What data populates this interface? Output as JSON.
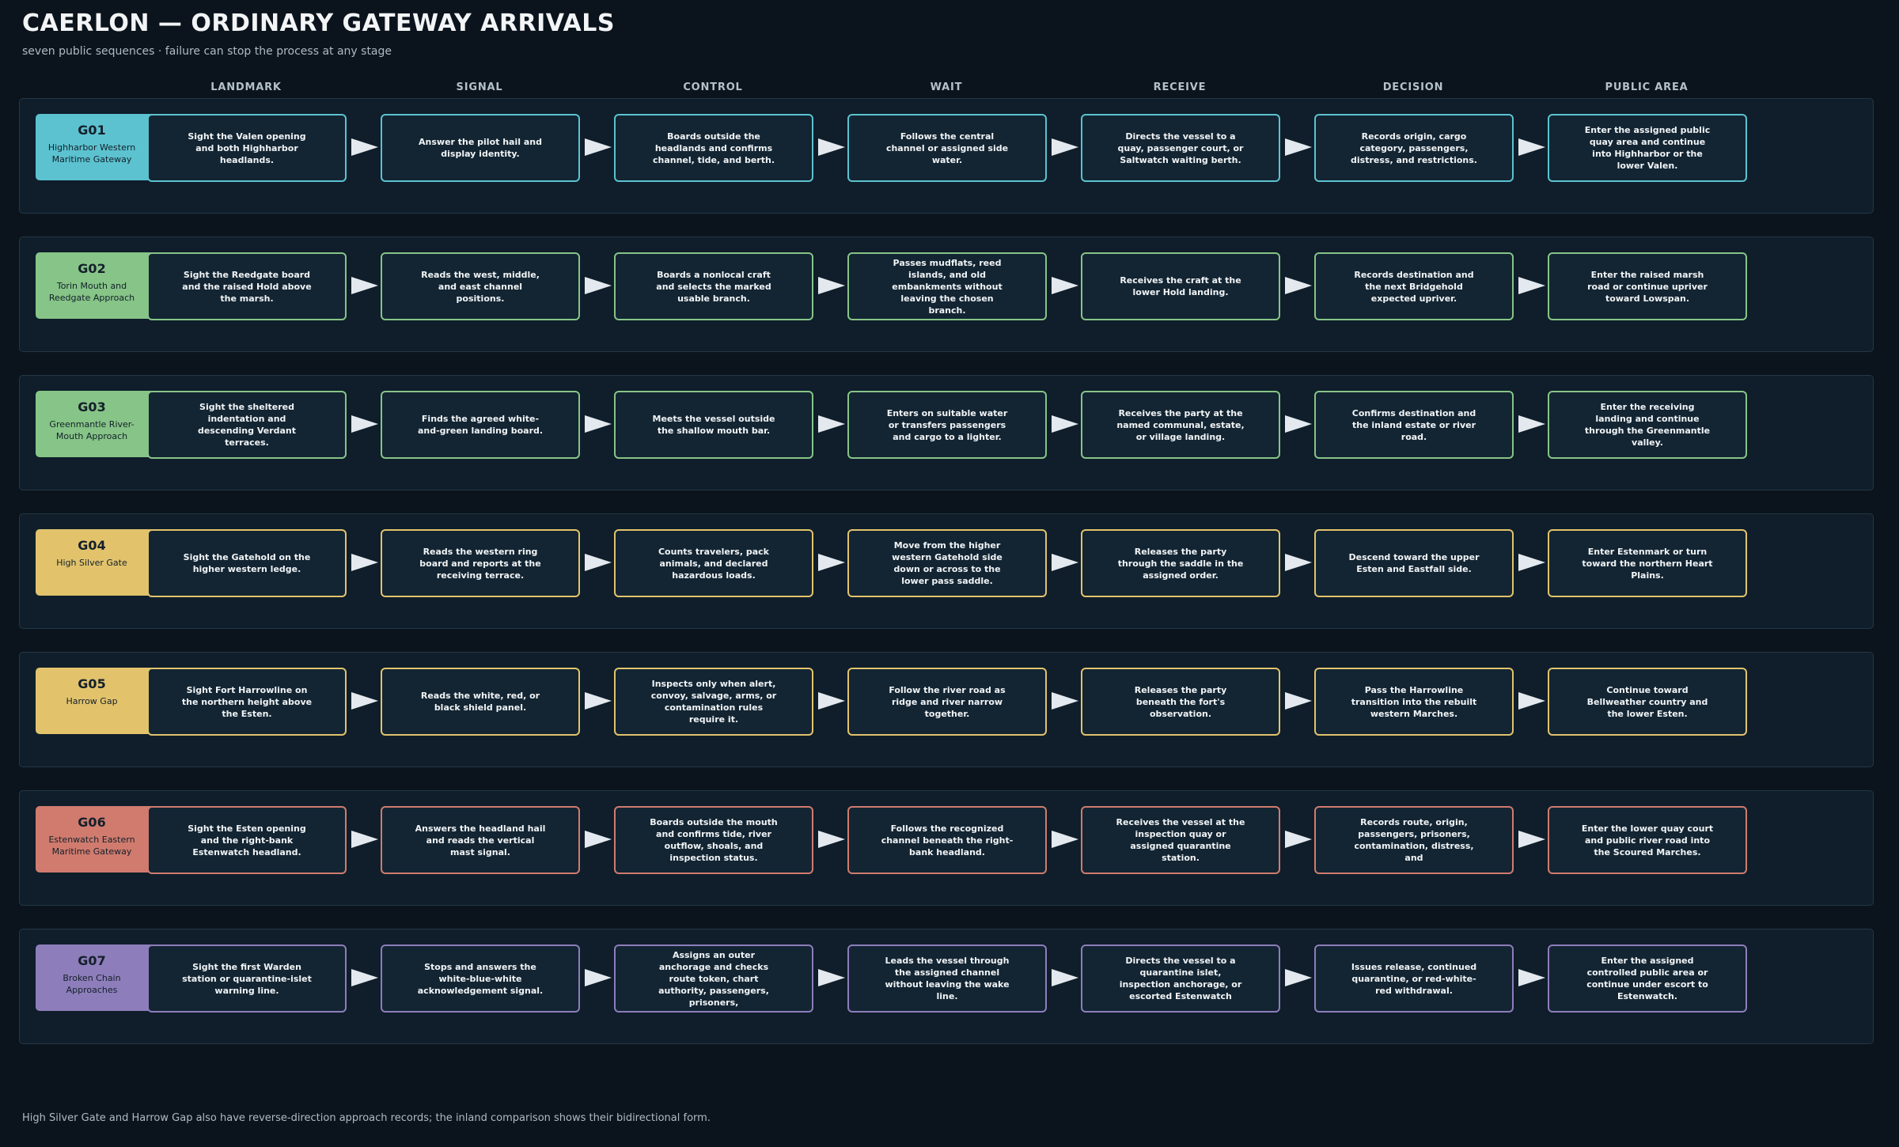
{
  "title": "CAERLON — ORDINARY GATEWAY ARRIVALS",
  "subtitle": "seven public sequences · failure can stop the process at any stage",
  "columns": [
    "LANDMARK",
    "SIGNAL",
    "CONTROL",
    "WAIT",
    "RECEIVE",
    "DECISION",
    "PUBLIC AREA"
  ],
  "gateways": [
    {
      "id": "G01",
      "name": "Highharbor Western Maritime Gateway",
      "color": "#5cc2d0",
      "steps": [
        "Sight the Valen opening and both Highharbor headlands.",
        "Answer the pilot hail and display identity.",
        "Boards outside the headlands and confirms channel, tide, and berth.",
        "Follows the central channel or assigned side water.",
        "Directs the vessel to a quay, passenger court, or Saltwatch waiting berth.",
        "Records origin, cargo category, passengers, distress, and restrictions.",
        "Enter the assigned public quay area and continue into Highharbor or the lower Valen."
      ]
    },
    {
      "id": "G02",
      "name": "Torin Mouth and Reedgate Approach",
      "color": "#86c487",
      "steps": [
        "Sight the Reedgate board and the raised Hold above the marsh.",
        "Reads the west, middle, and east channel positions.",
        "Boards a nonlocal craft and selects the marked usable branch.",
        "Passes mudflats, reed islands, and old embankments without leaving the chosen branch.",
        "Receives the craft at the lower Hold landing.",
        "Records destination and the next Bridgehold expected upriver.",
        "Enter the raised marsh road or continue upriver toward Lowspan."
      ]
    },
    {
      "id": "G03",
      "name": "Greenmantle River-Mouth Approach",
      "color": "#86c487",
      "steps": [
        "Sight the sheltered indentation and descending Verdant terraces.",
        "Finds the agreed white-and-green landing board.",
        "Meets the vessel outside the shallow mouth bar.",
        "Enters on suitable water or transfers passengers and cargo to a lighter.",
        "Receives the party at the named communal, estate, or village landing.",
        "Confirms destination and the inland estate or river road.",
        "Enter the receiving landing and continue through the Greenmantle valley."
      ]
    },
    {
      "id": "G04",
      "name": "High Silver Gate",
      "color": "#e2c36c",
      "steps": [
        "Sight the Gatehold on the higher western ledge.",
        "Reads the western ring board and reports at the receiving terrace.",
        "Counts travelers, pack animals, and declared hazardous loads.",
        "Move from the higher western Gatehold side down or across to the lower pass saddle.",
        "Releases the party through the saddle in the assigned order.",
        "Descend toward the upper Esten and Eastfall side.",
        "Enter Estenmark or turn toward the northern Heart Plains."
      ]
    },
    {
      "id": "G05",
      "name": "Harrow Gap",
      "color": "#e2c36c",
      "steps": [
        "Sight Fort Harrowline on the northern height above the Esten.",
        "Reads the white, red, or black shield panel.",
        "Inspects only when alert, convoy, salvage, arms, or contamination rules require it.",
        "Follow the river road as ridge and river narrow together.",
        "Releases the party beneath the fort's observation.",
        "Pass the Harrowline transition into the rebuilt western Marches.",
        "Continue toward Bellweather country and the lower Esten."
      ]
    },
    {
      "id": "G06",
      "name": "Estenwatch Eastern Maritime Gateway",
      "color": "#d07b6e",
      "steps": [
        "Sight the Esten opening and the right-bank Estenwatch headland.",
        "Answers the headland hail and reads the vertical mast signal.",
        "Boards outside the mouth and confirms tide, river outflow, shoals, and inspection status.",
        "Follows the recognized channel beneath the right-bank headland.",
        "Receives the vessel at the inspection quay or assigned quarantine station.",
        "Records route, origin, passengers, prisoners, contamination, distress, and",
        "Enter the lower quay court and public river road into the Scoured Marches."
      ]
    },
    {
      "id": "G07",
      "name": "Broken Chain Approaches",
      "color": "#8d7dbb",
      "steps": [
        "Sight the first Warden station or quarantine-islet warning line.",
        "Stops and answers the white-blue-white acknowledgement signal.",
        "Assigns an outer anchorage and checks route token, chart authority, passengers, prisoners,",
        "Leads the vessel through the assigned channel without leaving the wake line.",
        "Directs the vessel to a quarantine islet, inspection anchorage, or escorted Estenwatch",
        "Issues release, continued quarantine, or red-white-red withdrawal.",
        "Enter the assigned controlled public area or continue under escort to Estenwatch."
      ]
    }
  ],
  "footnote": "High Silver Gate and Harrow Gap also have reverse-direction approach records; the inland comparison shows their bidirectional form."
}
